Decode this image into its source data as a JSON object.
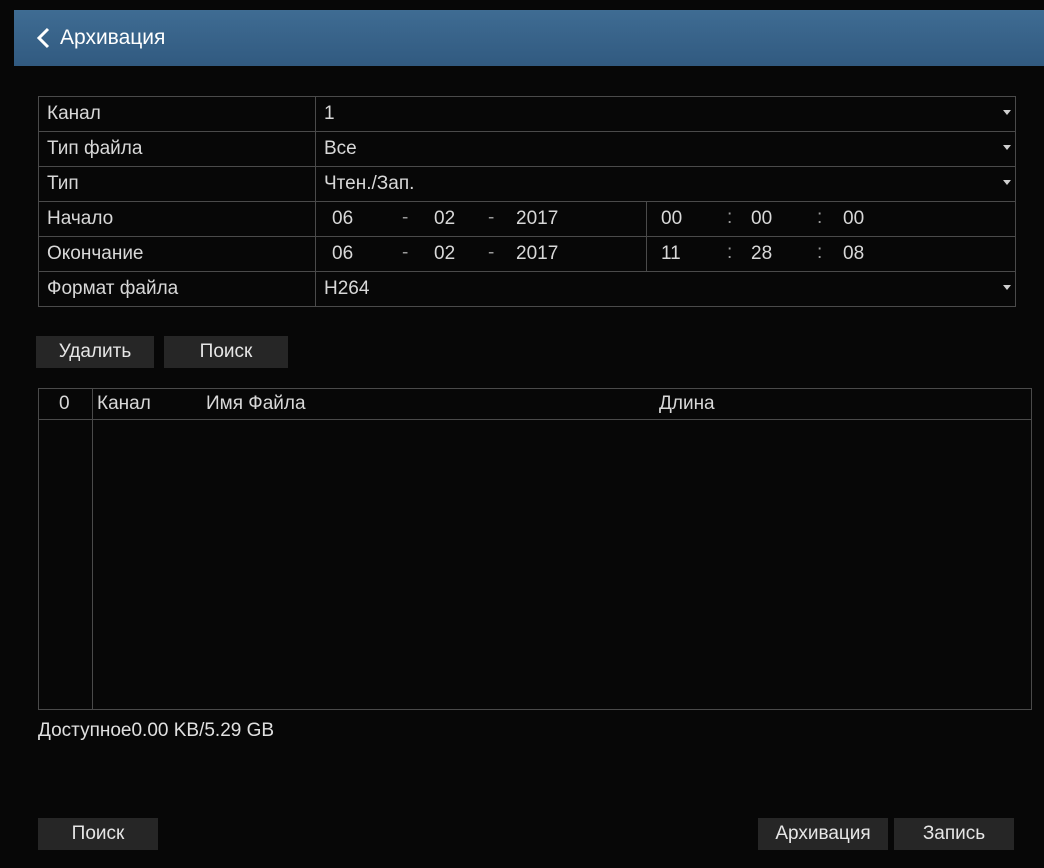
{
  "header": {
    "title": "Архивация",
    "back_icon": "chevron-left-icon"
  },
  "form": {
    "channel": {
      "label": "Канал",
      "value": "1"
    },
    "file_type": {
      "label": "Тип файла",
      "value": "Все"
    },
    "type": {
      "label": "Тип",
      "value": "Чтен./Зап."
    },
    "start": {
      "label": "Начало",
      "day": "06",
      "month": "02",
      "year": "2017",
      "hour": "00",
      "minute": "00",
      "second": "00"
    },
    "end": {
      "label": "Окончание",
      "day": "06",
      "month": "02",
      "year": "2017",
      "hour": "11",
      "minute": "28",
      "second": "08"
    },
    "file_format": {
      "label": "Формат файла",
      "value": "H264"
    },
    "date_sep": "-",
    "time_sep": ":"
  },
  "actions": {
    "delete": "Удалить",
    "search": "Поиск"
  },
  "list": {
    "columns": {
      "index": "0",
      "channel": "Канал",
      "filename": "Имя Файла",
      "length": "Длина"
    }
  },
  "status": {
    "available": "Доступное0.00 KB/5.29 GB"
  },
  "footer": {
    "search": "Поиск",
    "archive": "Архивация",
    "record": "Запись"
  },
  "colors": {
    "header": "#3a6489",
    "background": "#070707",
    "button": "#262626",
    "border": "#4a4a4a"
  }
}
